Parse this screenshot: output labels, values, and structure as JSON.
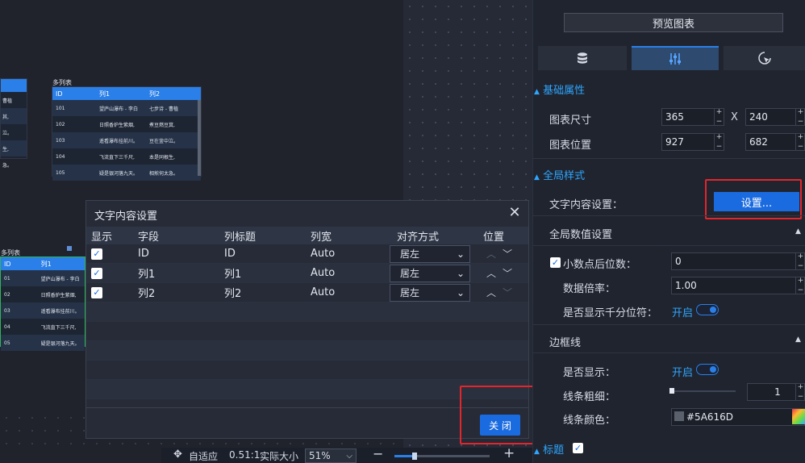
{
  "canvas": {
    "mini_top": {
      "caption": "多列表",
      "headers": [
        "ID",
        "列1",
        "列2"
      ],
      "rows": [
        [
          "101",
          "望庐山瀑布 - 李白",
          "七步诗 - 曹植"
        ],
        [
          "102",
          "日照香炉生紫烟,",
          "煮豆燃豆萁,"
        ],
        [
          "103",
          "遥看瀑布挂前川。",
          "豆在釜中泣。"
        ],
        [
          "104",
          "飞流直下三千尺,",
          "本是同根生,"
        ],
        [
          "105",
          "疑是银河落九天。",
          "相煎何太急。"
        ]
      ]
    },
    "mini_left_top": {
      "rows": [
        "曹植",
        "其,",
        "泣。",
        "生,",
        "急。"
      ]
    },
    "mini_bottom": {
      "caption": "多列表",
      "headers": [
        "ID",
        "列1"
      ],
      "rows": [
        [
          "01",
          "望庐山瀑布 - 李白"
        ],
        [
          "02",
          "日照香炉生紫烟,"
        ],
        [
          "03",
          "遥看瀑布挂前川。"
        ],
        [
          "04",
          "飞流直下三千尺,"
        ],
        [
          "05",
          "疑是银河落九天。"
        ]
      ]
    }
  },
  "bottombar": {
    "fit_label": "自适应",
    "ratio": "0.51:1",
    "actual_size": "实际大小",
    "zoom": "51%",
    "minus": "−",
    "plus": "+"
  },
  "dialog": {
    "title": "文字内容设置",
    "close_label": "关 闭",
    "headers": {
      "show": "显示",
      "field": "字段",
      "title": "列标题",
      "width": "列宽",
      "align": "对齐方式",
      "position": "位置"
    },
    "rows": [
      {
        "field": "ID",
        "title": "ID",
        "width": "Auto",
        "align": "居左",
        "checked": true
      },
      {
        "field": "列1",
        "title": "列1",
        "width": "Auto",
        "align": "居左",
        "checked": true
      },
      {
        "field": "列2",
        "title": "列2",
        "width": "Auto",
        "align": "居左",
        "checked": true
      }
    ]
  },
  "panel": {
    "preview_button": "预览图表",
    "tabs": [
      {
        "icon": "database-icon"
      },
      {
        "icon": "sliders-icon",
        "active": true
      },
      {
        "icon": "cursor-icon"
      }
    ],
    "basic": {
      "title": "基础属性",
      "size_label": "图表尺寸",
      "width": "365",
      "x_label": "X",
      "height": "240",
      "pos_label": "图表位置",
      "pos_x": "927",
      "pos_y": "682"
    },
    "global": {
      "title": "全局样式",
      "text_setting_label": "文字内容设置：",
      "text_setting_button": "设置...",
      "numeric_title": "全局数值设置",
      "decimals_label": "小数点后位数：",
      "decimals_value": "0",
      "multiplier_label": "数据倍率：",
      "multiplier_value": "1.00",
      "thousands_label": "是否显示千分位符：",
      "thousands_state": "开启"
    },
    "border": {
      "title": "边框线",
      "show_label": "是否显示：",
      "show_state": "开启",
      "thickness_label": "线条粗细：",
      "thickness_value": "1",
      "color_label": "线条颜色：",
      "color_value": "#5A616D"
    },
    "title_section": {
      "title": "标题"
    }
  },
  "colors": {
    "accent": "#2a7fe8",
    "highlight_box": "#e4252b",
    "border_color_swatch": "#5A616D"
  }
}
